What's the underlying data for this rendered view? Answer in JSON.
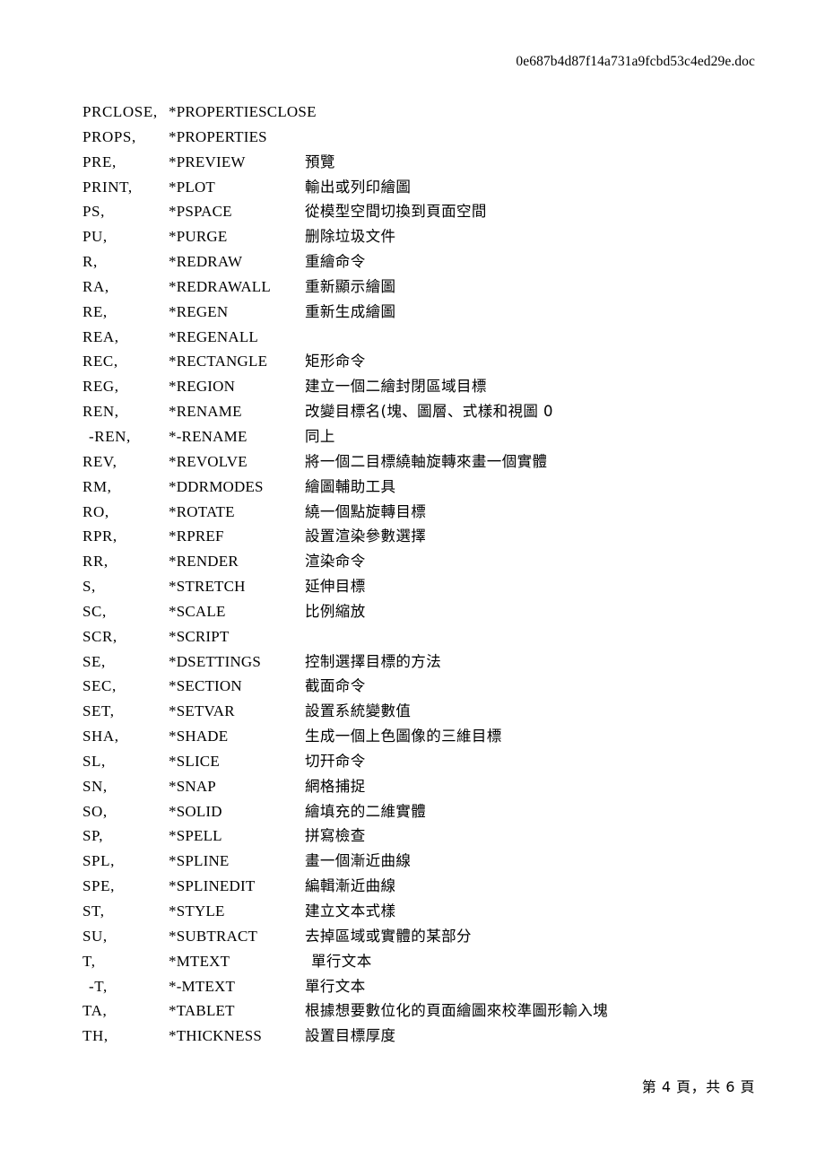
{
  "header": {
    "filename": "0e687b4d87f14a731a9fcbd53c4ed29e.doc"
  },
  "footer": {
    "page_label": "第 4 頁，共 6 頁"
  },
  "table": {
    "rows": [
      {
        "alias": "PRCLOSE,",
        "command": "*PROPERTIESCLOSE",
        "desc": ""
      },
      {
        "alias": "PROPS,",
        "command": "*PROPERTIES",
        "desc": ""
      },
      {
        "alias": "PRE,",
        "command": "*PREVIEW",
        "desc": "預覽"
      },
      {
        "alias": "PRINT,",
        "command": "*PLOT",
        "desc": "輸出或列印繪圖"
      },
      {
        "alias": "PS,",
        "command": "*PSPACE",
        "desc": "從模型空間切換到頁面空間"
      },
      {
        "alias": "PU,",
        "command": "*PURGE",
        "desc": "删除垃圾文件"
      },
      {
        "alias": "R,",
        "command": "*REDRAW",
        "desc": "重繪命令"
      },
      {
        "alias": "RA,",
        "command": "*REDRAWALL",
        "desc": "重新顯示繪圖"
      },
      {
        "alias": "RE,",
        "command": "*REGEN",
        "desc": "重新生成繪圖"
      },
      {
        "alias": "REA,",
        "command": "*REGENALL",
        "desc": ""
      },
      {
        "alias": "REC,",
        "command": "*RECTANGLE",
        "desc": "矩形命令"
      },
      {
        "alias": "REG,",
        "command": "*REGION",
        "desc": "建立一個二繪封閉區域目標"
      },
      {
        "alias": "REN,",
        "command": "*RENAME",
        "desc": "改變目標名(塊、圖層、式樣和視圖 0"
      },
      {
        "alias": "-REN,",
        "command": "*-RENAME",
        "desc": "同上",
        "indent_alias": true
      },
      {
        "alias": "REV,",
        "command": "*REVOLVE",
        "desc": "將一個二目標繞軸旋轉來畫一個實體"
      },
      {
        "alias": "RM,",
        "command": "*DDRMODES",
        "desc": "繪圖輔助工具"
      },
      {
        "alias": "RO,",
        "command": "*ROTATE",
        "desc": "繞一個點旋轉目標"
      },
      {
        "alias": "RPR,",
        "command": "*RPREF",
        "desc": "設置渲染參數選擇"
      },
      {
        "alias": "RR,",
        "command": "*RENDER",
        "desc": "渲染命令"
      },
      {
        "alias": "S,",
        "command": "*STRETCH",
        "desc": "延伸目標"
      },
      {
        "alias": "SC,",
        "command": "*SCALE",
        "desc": "比例縮放"
      },
      {
        "alias": "SCR,",
        "command": "*SCRIPT",
        "desc": ""
      },
      {
        "alias": "SE,",
        "command": "*DSETTINGS",
        "desc": "控制選擇目標的方法"
      },
      {
        "alias": "SEC,",
        "command": "*SECTION",
        "desc": "截面命令"
      },
      {
        "alias": "SET,",
        "command": "*SETVAR",
        "desc": "設置系統變數值"
      },
      {
        "alias": "SHA,",
        "command": "*SHADE",
        "desc": "生成一個上色圖像的三維目標"
      },
      {
        "alias": "SL,",
        "command": "*SLICE",
        "desc": "切幵命令"
      },
      {
        "alias": "SN,",
        "command": "*SNAP",
        "desc": "網格捕捉"
      },
      {
        "alias": "SO,",
        "command": "*SOLID",
        "desc": "繪填充的二維實體"
      },
      {
        "alias": "SP,",
        "command": "*SPELL",
        "desc": "拼寫檢查"
      },
      {
        "alias": "SPL,",
        "command": "*SPLINE",
        "desc": "畫一個漸近曲線"
      },
      {
        "alias": "SPE,",
        "command": "*SPLINEDIT",
        "desc": "編輯漸近曲線"
      },
      {
        "alias": "ST,",
        "command": "*STYLE",
        "desc": "建立文本式樣"
      },
      {
        "alias": "SU,",
        "command": "*SUBTRACT",
        "desc": "去掉區域或實體的某部分"
      },
      {
        "alias": "T,",
        "command": "*MTEXT",
        "desc": "單行文本",
        "indent_desc": true
      },
      {
        "alias": "-T,",
        "command": "*-MTEXT",
        "desc": "單行文本",
        "indent_alias": true
      },
      {
        "alias": "TA,",
        "command": "*TABLET",
        "desc": "根據想要數位化的頁面繪圖來校準圖形輸入塊"
      },
      {
        "alias": "TH,",
        "command": "*THICKNESS",
        "desc": "設置目標厚度"
      }
    ]
  }
}
